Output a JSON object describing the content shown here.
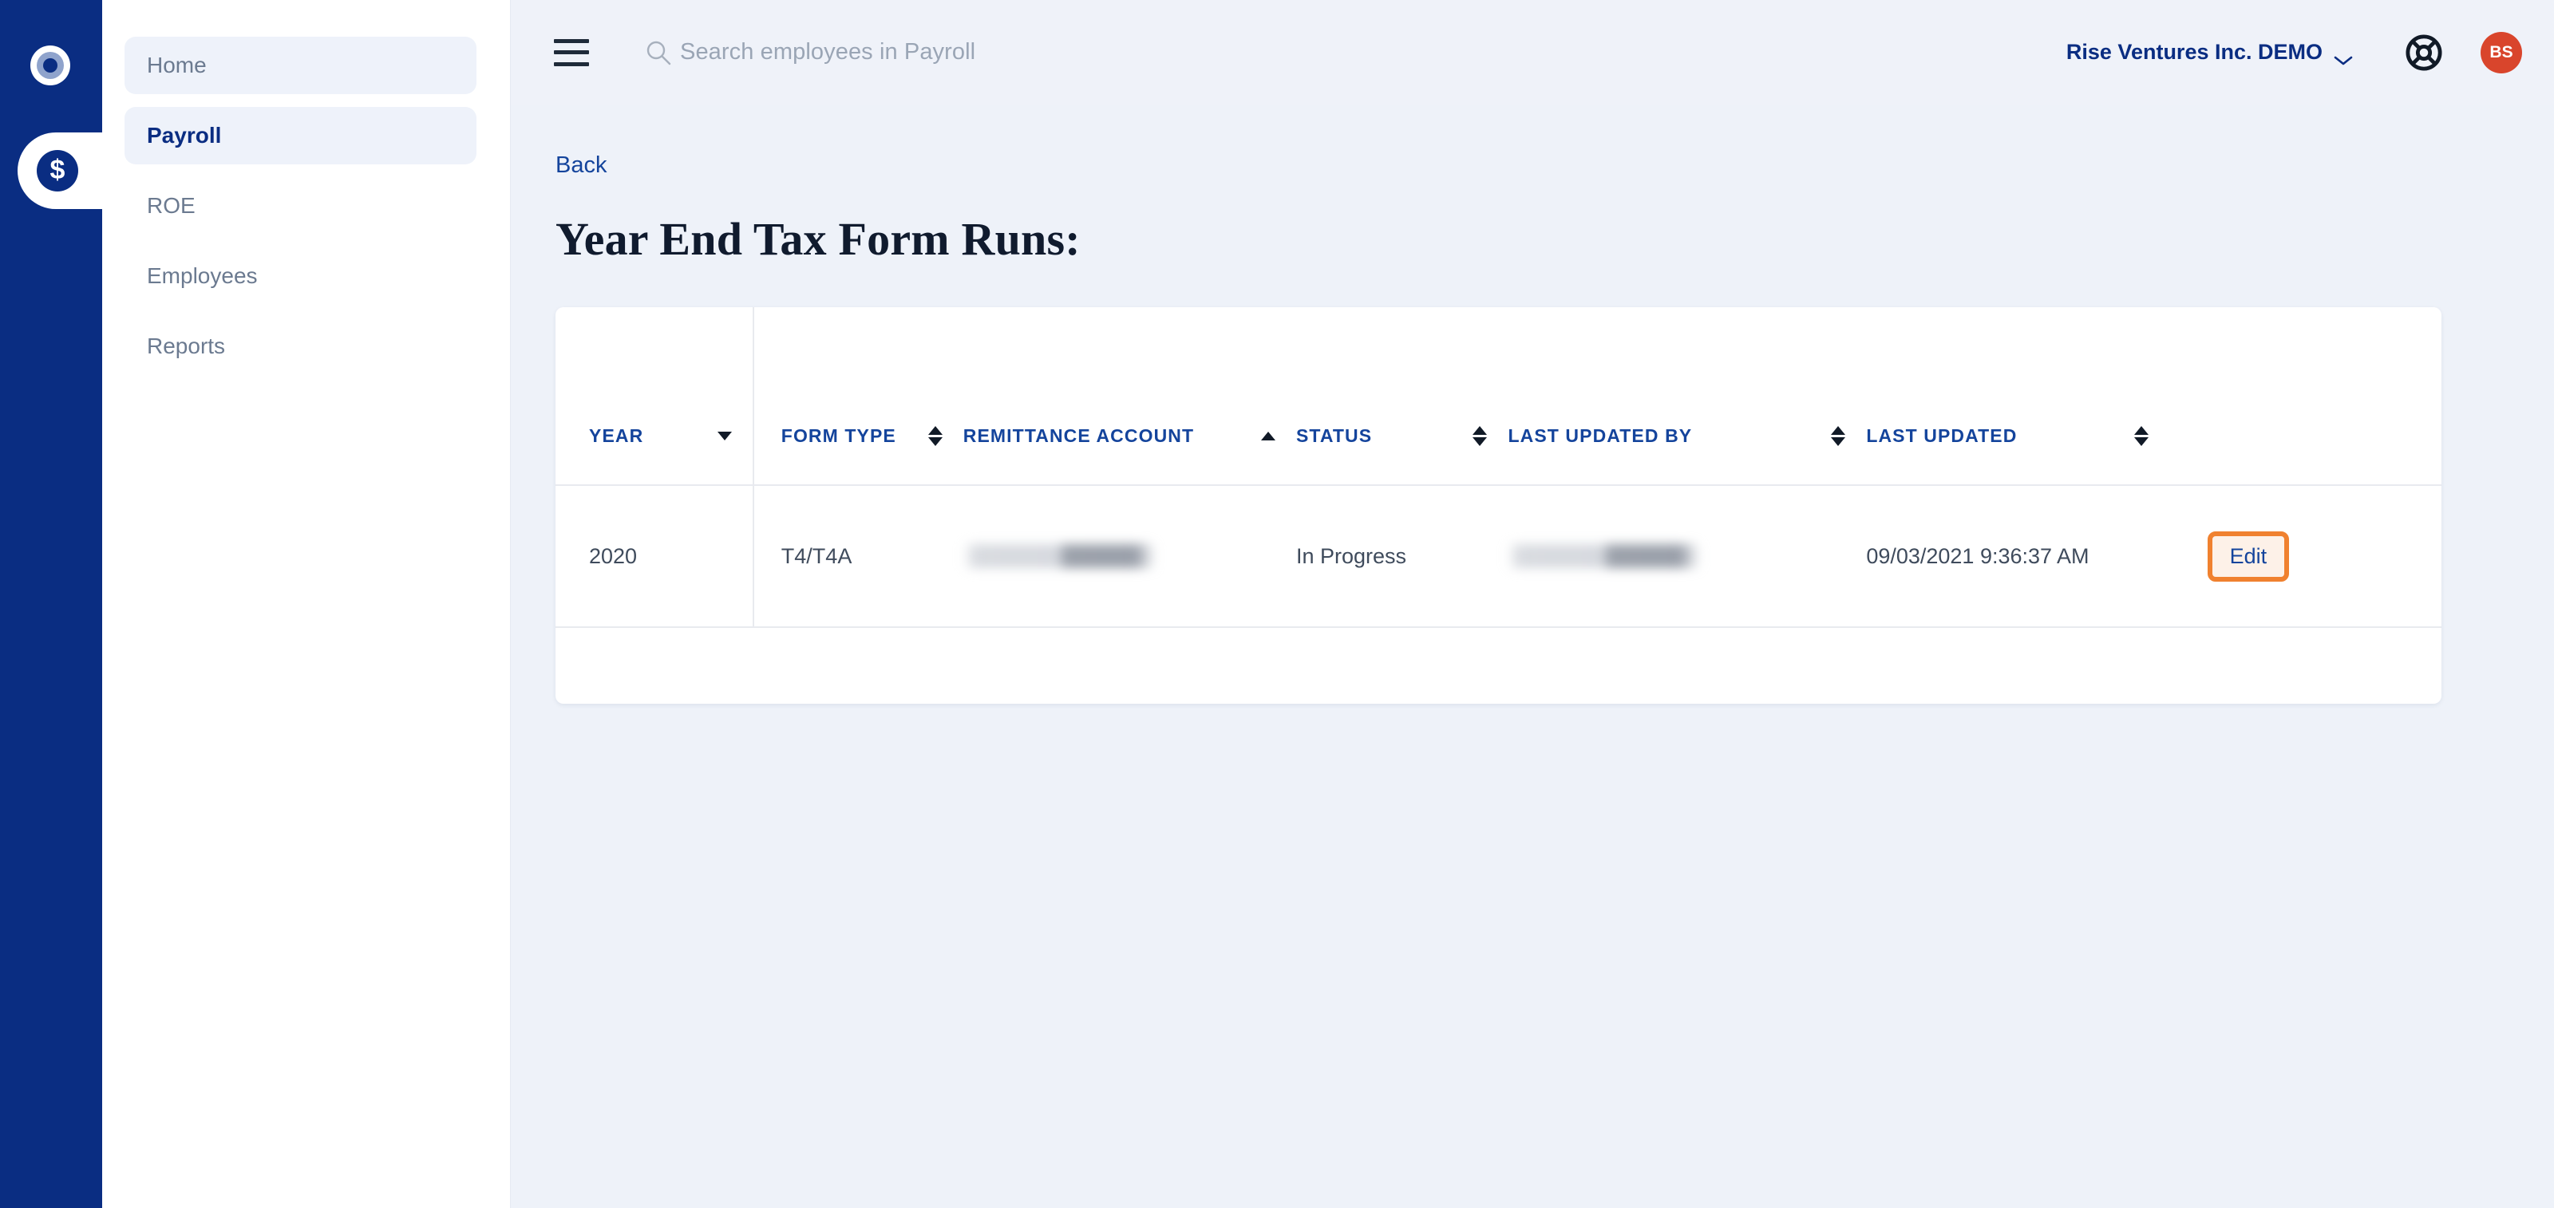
{
  "brand": {
    "rail_icon": "ring-logo-icon",
    "module_icon": "dollar-icon",
    "accent_blue": "#0a2d82",
    "accent_orange": "#f0812f",
    "avatar_color": "#d9452c"
  },
  "sidebar": {
    "items": [
      {
        "label": "Home",
        "name": "sidebar-item-home",
        "tinted": true,
        "active": false
      },
      {
        "label": "Payroll",
        "name": "sidebar-item-payroll",
        "tinted": true,
        "active": true
      },
      {
        "label": "ROE",
        "name": "sidebar-item-roe",
        "tinted": false,
        "active": false
      },
      {
        "label": "Employees",
        "name": "sidebar-item-employees",
        "tinted": false,
        "active": false
      },
      {
        "label": "Reports",
        "name": "sidebar-item-reports",
        "tinted": false,
        "active": false
      }
    ]
  },
  "topbar": {
    "menu_icon": "hamburger-menu-icon",
    "search": {
      "icon": "search-icon",
      "value": "",
      "placeholder": "Search employees in Payroll"
    },
    "company": "Rise Ventures Inc. DEMO",
    "company_chevron": "chevron-down-icon",
    "help_icon": "lifebuoy-help-icon",
    "avatar_initials": "BS"
  },
  "content": {
    "back_label": "Back",
    "page_title": "Year End Tax Form Runs:"
  },
  "table": {
    "columns": [
      {
        "label": "YEAR",
        "sort": "desc"
      },
      {
        "label": "FORM TYPE",
        "sort": "none"
      },
      {
        "label": "REMITTANCE ACCOUNT",
        "sort": "asc"
      },
      {
        "label": "STATUS",
        "sort": "none"
      },
      {
        "label": "LAST UPDATED BY",
        "sort": "none"
      },
      {
        "label": "LAST UPDATED",
        "sort": "none"
      },
      {
        "label": "",
        "sort": null
      }
    ],
    "rows": [
      {
        "year": "2020",
        "form_type": "T4/T4A",
        "remittance_account": "",
        "status": "In Progress",
        "last_updated_by": "",
        "last_updated": "09/03/2021 9:36:37 AM",
        "action_label": "Edit"
      }
    ]
  }
}
